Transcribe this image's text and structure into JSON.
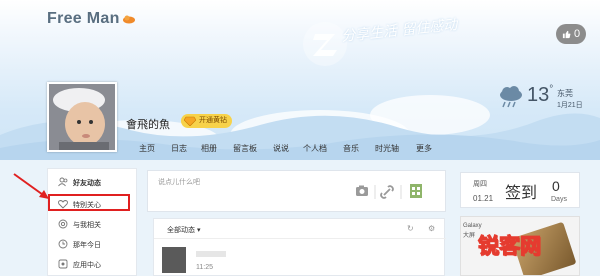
{
  "profile": {
    "space_title": "Free Man",
    "slogan": "分享生活 留住感动",
    "username": "會飛的魚",
    "vip_label": "开通黄钻",
    "like_count": "0"
  },
  "weather": {
    "temperature": "13",
    "degree_mark": "°",
    "city": "东莞",
    "date": "1月21日"
  },
  "nav": {
    "items": [
      "主页",
      "日志",
      "相册",
      "留言板",
      "说说",
      "个人档",
      "音乐",
      "时光轴",
      "更多"
    ]
  },
  "sidebar": {
    "items": [
      {
        "label": "好友动态",
        "icon": "friends-icon",
        "bold": true
      },
      {
        "label": "特别关心",
        "icon": "heart-icon",
        "bold": false
      },
      {
        "label": "与我相关",
        "icon": "at-icon",
        "bold": false
      },
      {
        "label": "那年今日",
        "icon": "clock-icon",
        "bold": false
      },
      {
        "label": "应用中心",
        "icon": "apps-icon",
        "bold": false
      }
    ]
  },
  "composer": {
    "placeholder": "说点儿什么吧"
  },
  "feed": {
    "title": "全部动态",
    "time": "11:25"
  },
  "checkin": {
    "weekday": "周四",
    "date": "01.21",
    "label": "签到",
    "count": "0",
    "unit": "Days"
  },
  "ad": {
    "line1": "Galaxy",
    "line2": "大屏"
  },
  "watermark": "锐客网",
  "colors": {
    "highlight": "#e02020",
    "vip": "#f7d24a",
    "watermark": "#e53b2f"
  }
}
